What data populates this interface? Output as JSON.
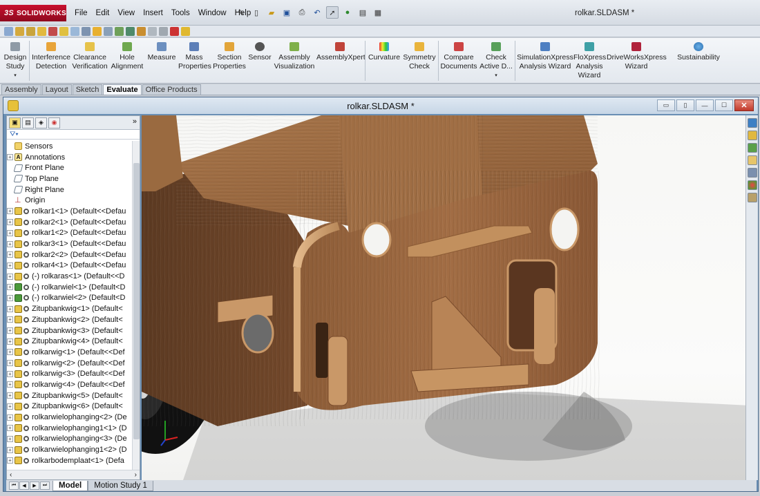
{
  "app": {
    "brand": "SOLIDWORKS",
    "title": "rolkar.SLDASM *"
  },
  "menu": [
    "File",
    "Edit",
    "View",
    "Insert",
    "Tools",
    "Window",
    "Help"
  ],
  "command_manager": [
    {
      "label": "Design\nStudy",
      "icon": "design-study-icon"
    },
    {
      "label": "Interference\nDetection",
      "icon": "interference-detection-icon"
    },
    {
      "label": "Clearance\nVerification",
      "icon": "clearance-verification-icon"
    },
    {
      "label": "Hole\nAlignment",
      "icon": "hole-alignment-icon"
    },
    {
      "label": "Measure",
      "icon": "measure-icon"
    },
    {
      "label": "Mass\nProperties",
      "icon": "mass-properties-icon"
    },
    {
      "label": "Section\nProperties",
      "icon": "section-properties-icon"
    },
    {
      "label": "Sensor",
      "icon": "sensor-icon"
    },
    {
      "label": "Assembly\nVisualization",
      "icon": "assembly-visualization-icon"
    },
    {
      "label": "AssemblyXpert",
      "icon": "assemblyxpert-icon"
    },
    {
      "label": "Curvature",
      "icon": "curvature-icon"
    },
    {
      "label": "Symmetry\nCheck",
      "icon": "symmetry-check-icon"
    },
    {
      "label": "Compare\nDocuments",
      "icon": "compare-documents-icon"
    },
    {
      "label": "Check\nActive D...",
      "icon": "check-active-document-icon"
    },
    {
      "label": "SimulationXpress\nAnalysis Wizard",
      "icon": "simulationxpress-icon"
    },
    {
      "label": "FloXpress\nAnalysis\nWizard",
      "icon": "floxpress-icon"
    },
    {
      "label": "DriveWorksXpress\nWizard",
      "icon": "driveworksxpress-icon"
    },
    {
      "label": "Sustainability",
      "icon": "sustainability-icon"
    }
  ],
  "command_tabs": [
    "Assembly",
    "Layout",
    "Sketch",
    "Evaluate",
    "Office Products"
  ],
  "active_command_tab": "Evaluate",
  "document": {
    "title": "rolkar.SLDASM *"
  },
  "feature_tree": [
    {
      "label": "Sensors",
      "icon": "sensor",
      "expand": ""
    },
    {
      "label": "Annotations",
      "icon": "annot",
      "expand": "+"
    },
    {
      "label": "Front Plane",
      "icon": "plane",
      "expand": ""
    },
    {
      "label": "Top Plane",
      "icon": "plane",
      "expand": ""
    },
    {
      "label": "Right Plane",
      "icon": "plane",
      "expand": ""
    },
    {
      "label": "Origin",
      "icon": "origin",
      "expand": ""
    },
    {
      "label": "rolkar1<1> (Default<<Defau",
      "icon": "part",
      "expand": "+"
    },
    {
      "label": "rolkar2<1> (Default<<Defau",
      "icon": "part",
      "expand": "+"
    },
    {
      "label": "rolkar1<2> (Default<<Defau",
      "icon": "part",
      "expand": "+"
    },
    {
      "label": "rolkar3<1> (Default<<Defau",
      "icon": "part",
      "expand": "+"
    },
    {
      "label": "rolkar2<2> (Default<<Defau",
      "icon": "part",
      "expand": "+"
    },
    {
      "label": "rolkar4<1> (Default<<Defau",
      "icon": "part",
      "expand": "+"
    },
    {
      "label": "(-) rolkaras<1> (Default<<D",
      "icon": "part",
      "expand": "+"
    },
    {
      "label": "(-) rolkarwiel<1> (Default<D",
      "icon": "asm",
      "expand": "+"
    },
    {
      "label": "(-) rolkarwiel<2> (Default<D",
      "icon": "asm",
      "expand": "+"
    },
    {
      "label": "Zitupbankwig<1> (Default<",
      "icon": "part",
      "expand": "+"
    },
    {
      "label": "Zitupbankwig<2> (Default<",
      "icon": "part",
      "expand": "+"
    },
    {
      "label": "Zitupbankwig<3> (Default<",
      "icon": "part",
      "expand": "+"
    },
    {
      "label": "Zitupbankwig<4> (Default<",
      "icon": "part",
      "expand": "+"
    },
    {
      "label": "rolkarwig<1> (Default<<Def",
      "icon": "part",
      "expand": "+"
    },
    {
      "label": "rolkarwig<2> (Default<<Def",
      "icon": "part",
      "expand": "+"
    },
    {
      "label": "rolkarwig<3> (Default<<Def",
      "icon": "part",
      "expand": "+"
    },
    {
      "label": "rolkarwig<4> (Default<<Def",
      "icon": "part",
      "expand": "+"
    },
    {
      "label": "Zitupbankwig<5> (Default<",
      "icon": "part",
      "expand": "+"
    },
    {
      "label": "Zitupbankwig<6> (Default<",
      "icon": "part",
      "expand": "+"
    },
    {
      "label": "rolkarwielophanging<2> (De",
      "icon": "part",
      "expand": "+"
    },
    {
      "label": "rolkarwielophanging1<1> (D",
      "icon": "part",
      "expand": "+"
    },
    {
      "label": "rolkarwielophanging<3> (De",
      "icon": "part",
      "expand": "+"
    },
    {
      "label": "rolkarwielophanging1<2> (D",
      "icon": "part",
      "expand": "+"
    },
    {
      "label": "rolkarbodemplaat<1> (Defa",
      "icon": "part",
      "expand": "+"
    }
  ],
  "bottom_tabs": [
    "Model",
    "Motion Study 1"
  ],
  "active_bottom_tab": "Model",
  "colors": {
    "wood_light": "#b98555",
    "wood_dark": "#6d4528",
    "tire": "#111111"
  }
}
